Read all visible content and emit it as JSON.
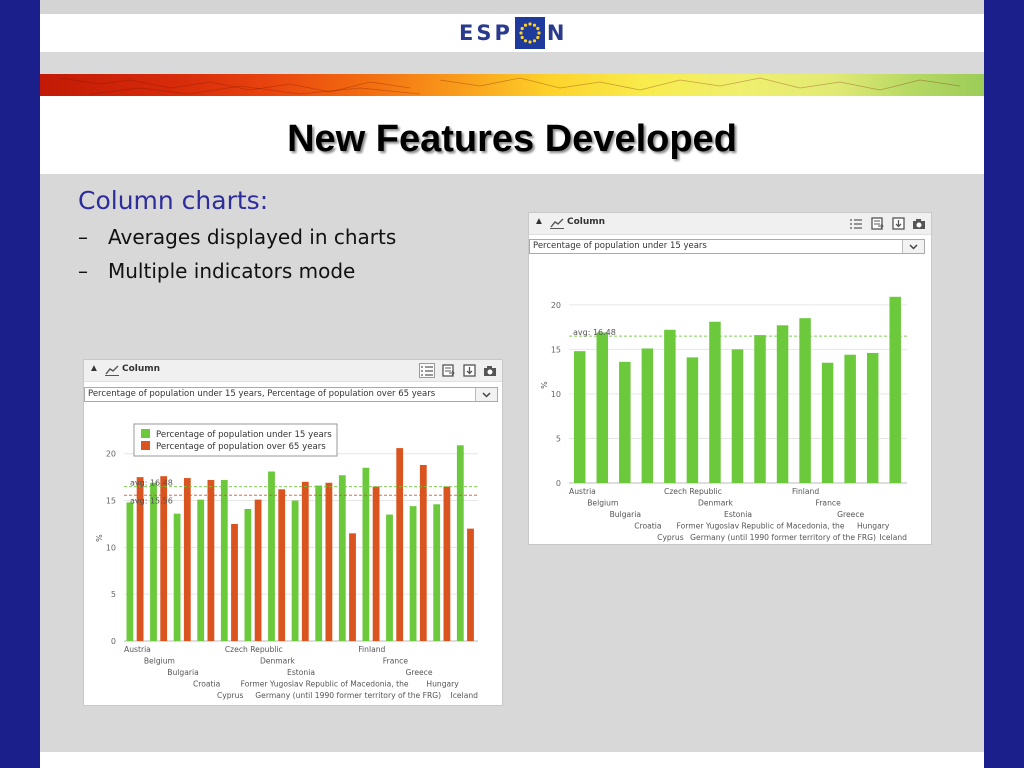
{
  "slide": {
    "logo_left": "ESP",
    "logo_right": "N",
    "title": "New Features Developed",
    "bullets": {
      "heading": "Column charts:",
      "items": [
        {
          "dash": "–",
          "text": "Averages displayed in charts"
        },
        {
          "dash": "–",
          "text": "Multiple indicators mode"
        }
      ]
    }
  },
  "panels": [
    {
      "title": "Column",
      "indicator": "Percentage of population under 15 years, Percentage of population over 65 years",
      "tools": [
        "legend-toggle-icon",
        "export-table-icon",
        "download-icon",
        "camera-icon"
      ],
      "legend_selected": true
    },
    {
      "title": "Column",
      "indicator": "Percentage of population under 15 years",
      "tools": [
        "legend-toggle-icon",
        "export-table-icon",
        "download-icon",
        "camera-icon"
      ],
      "legend_selected": false
    }
  ],
  "chart_data": [
    {
      "type": "bar",
      "ylabel": "%",
      "ylim": [
        0,
        22
      ],
      "yticks": [
        0,
        5,
        10,
        15,
        20
      ],
      "legend_position": "top-left",
      "categories": [
        "Austria",
        "Belgium",
        "Bulgaria",
        "Croatia",
        "Cyprus",
        "Czech Republic",
        "Denmark",
        "Estonia",
        "Former Yugoslav Republic of Macedonia, the",
        "Germany (until 1990 former territory of the FRG)",
        "Finland",
        "France",
        "Greece",
        "Hungary",
        "Iceland"
      ],
      "series": [
        {
          "name": "Percentage of population under 15 years",
          "color": "#6cc93c",
          "values": [
            14.8,
            16.9,
            13.6,
            15.1,
            17.2,
            14.1,
            18.1,
            15.0,
            16.6,
            17.7,
            18.5,
            13.5,
            14.4,
            14.6,
            20.9
          ],
          "average": 16.48
        },
        {
          "name": "Percentage of population over 65 years",
          "color": "#d9541e",
          "values": [
            17.5,
            17.6,
            17.4,
            17.2,
            12.5,
            15.1,
            16.2,
            17.0,
            16.9,
            11.5,
            16.5,
            20.6,
            18.8,
            16.5,
            12.0
          ],
          "average": 15.56
        }
      ],
      "average_labels": [
        "avg: 16.48",
        "avg: 15.56"
      ]
    },
    {
      "type": "bar",
      "ylabel": "%",
      "ylim": [
        0,
        22
      ],
      "yticks": [
        0,
        5,
        10,
        15,
        20
      ],
      "categories": [
        "Austria",
        "Belgium",
        "Bulgaria",
        "Croatia",
        "Cyprus",
        "Czech Republic",
        "Denmark",
        "Estonia",
        "Former Yugoslav Republic of Macedonia, the",
        "Germany (until 1990 former territory of the FRG)",
        "Finland",
        "France",
        "Greece",
        "Hungary",
        "Iceland"
      ],
      "series": [
        {
          "name": "Percentage of population under 15 years",
          "color": "#6cc93c",
          "values": [
            14.8,
            16.9,
            13.6,
            15.1,
            17.2,
            14.1,
            18.1,
            15.0,
            16.6,
            17.7,
            18.5,
            13.5,
            14.4,
            14.6,
            20.9
          ],
          "average": 16.48
        }
      ],
      "average_labels": [
        "avg: 16.48"
      ]
    }
  ]
}
